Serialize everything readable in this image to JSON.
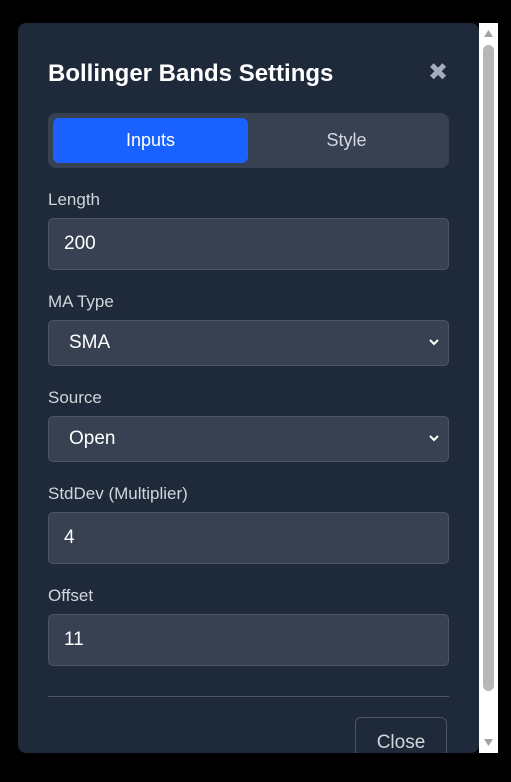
{
  "dialog": {
    "title": "Bollinger Bands Settings",
    "close_glyph": "✖"
  },
  "tabs": [
    {
      "label": "Inputs",
      "active": true
    },
    {
      "label": "Style",
      "active": false
    }
  ],
  "fields": {
    "length": {
      "label": "Length",
      "value": "200"
    },
    "ma_type": {
      "label": "MA Type",
      "value": "SMA"
    },
    "source": {
      "label": "Source",
      "value": "Open"
    },
    "stddev": {
      "label": "StdDev (Multiplier)",
      "value": "4"
    },
    "offset": {
      "label": "Offset",
      "value": "11"
    }
  },
  "footer": {
    "close_label": "Close"
  },
  "colors": {
    "dialog_bg": "#1e2939",
    "accent": "#1a62ff",
    "input_bg": "#374151"
  },
  "icons": {
    "close": "close-icon",
    "select": "chevron-down-icon",
    "scroll_up": "scroll-up-arrow-icon",
    "scroll_down": "scroll-down-arrow-icon"
  }
}
